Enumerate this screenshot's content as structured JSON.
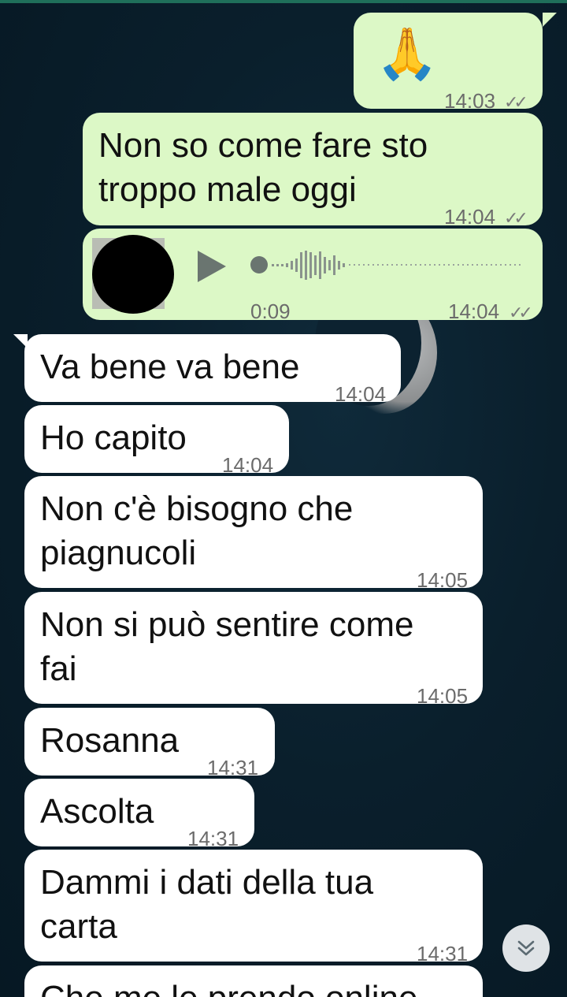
{
  "messages": [
    {
      "dir": "out",
      "emoji": "🙏",
      "time": "14:03",
      "ticks": "✓✓"
    },
    {
      "dir": "out",
      "text": "Non so come fare sto\ntroppo male oggi",
      "time": "14:04",
      "ticks": "✓✓"
    },
    {
      "dir": "out",
      "type": "voice",
      "duration": "0:09",
      "time": "14:04",
      "ticks": "✓✓"
    },
    {
      "dir": "in",
      "text": "Va bene va bene",
      "time": "14:04"
    },
    {
      "dir": "in",
      "text": "Ho capito",
      "time": "14:04"
    },
    {
      "dir": "in",
      "text": "Non c'è bisogno che\npiagnucoli",
      "time": "14:05"
    },
    {
      "dir": "in",
      "text": "Non si può sentire come\nfai",
      "time": "14:05"
    },
    {
      "dir": "in",
      "text": "Rosanna",
      "time": "14:31"
    },
    {
      "dir": "in",
      "text": "Ascolta",
      "time": "14:31"
    },
    {
      "dir": "in",
      "text": "Dammi i dati della tua\ncarta",
      "time": "14:31"
    },
    {
      "dir": "in",
      "text": "Che me le prendo online"
    }
  ],
  "icons": {
    "play": "play-icon",
    "scroll_down": "chevron-double-down-icon"
  },
  "colors": {
    "outgoing": "#dcf8c6",
    "incoming": "#ffffff",
    "time": "#6b6b6b"
  }
}
